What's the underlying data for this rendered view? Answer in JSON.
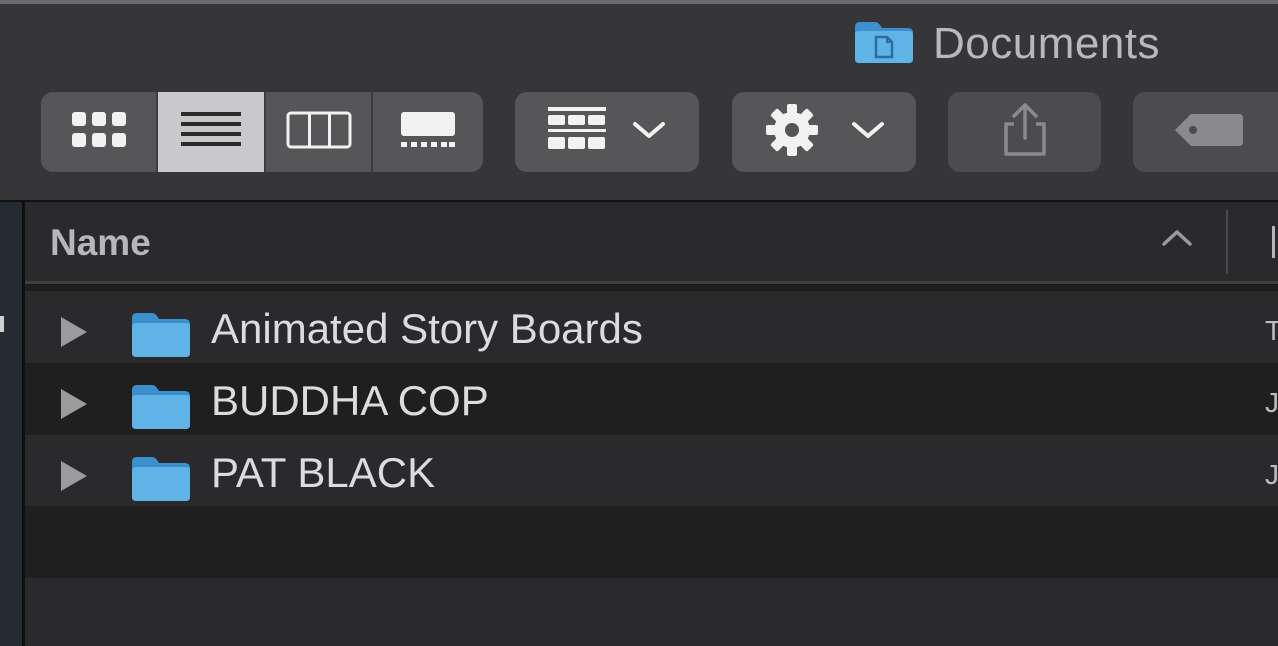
{
  "window": {
    "title": "Documents",
    "title_icon": "folder-icon"
  },
  "toolbar": {
    "view_modes": [
      {
        "name": "icon-view",
        "icon": "grid-icon",
        "active": false
      },
      {
        "name": "list-view",
        "icon": "list-icon",
        "active": true
      },
      {
        "name": "column-view",
        "icon": "columns-icon",
        "active": false
      },
      {
        "name": "gallery-view",
        "icon": "gallery-icon",
        "active": false
      }
    ],
    "group_button_icon": "group-icon",
    "action_button_icon": "gear-icon",
    "share_button_icon": "share-icon",
    "tag_button_icon": "tag-icon"
  },
  "table": {
    "header_name": "Name",
    "sort_direction": "ascending",
    "rows": [
      {
        "name": "Animated Story Boards",
        "kind": "folder",
        "next_col_hint": "T"
      },
      {
        "name": "BUDDHA COP",
        "kind": "folder",
        "next_col_hint": "J"
      },
      {
        "name": "PAT BLACK",
        "kind": "folder",
        "next_col_hint": "J"
      }
    ]
  },
  "colors": {
    "folder_blue": "#5fb3e6",
    "toolbar_bg": "#363638",
    "button_bg": "#565658",
    "active_segment": "#c9c9cb"
  }
}
